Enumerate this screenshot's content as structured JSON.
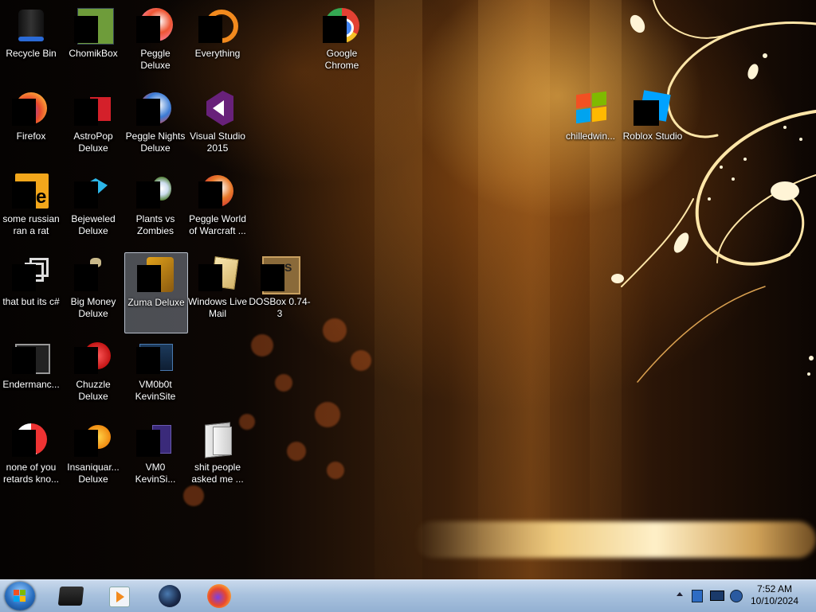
{
  "desktop": {
    "icons": [
      {
        "name": "icon-recycle-bin",
        "label": "Recycle Bin"
      },
      {
        "name": "icon-chomikbox",
        "label": "ChomikBox"
      },
      {
        "name": "icon-peggle-deluxe",
        "label": "Peggle Deluxe"
      },
      {
        "name": "icon-everything",
        "label": "Everything"
      },
      {
        "name": "icon-google-chrome",
        "label": "Google Chrome"
      },
      {
        "name": "icon-firefox",
        "label": "Firefox"
      },
      {
        "name": "icon-astropop-deluxe",
        "label": "AstroPop Deluxe"
      },
      {
        "name": "icon-peggle-nights-deluxe",
        "label": "Peggle Nights Deluxe"
      },
      {
        "name": "icon-visual-studio-2015",
        "label": "Visual Studio 2015"
      },
      {
        "name": "icon-chilledwin",
        "label": "chilledwin..."
      },
      {
        "name": "icon-roblox-studio",
        "label": "Roblox Studio"
      },
      {
        "name": "icon-some-russian-ran-a-rat",
        "label": "some russian ran a rat"
      },
      {
        "name": "icon-bejeweled-deluxe",
        "label": "Bejeweled Deluxe"
      },
      {
        "name": "icon-plants-vs-zombies",
        "label": "Plants vs Zombies"
      },
      {
        "name": "icon-peggle-world-of-warcraft",
        "label": "Peggle World of Warcraft ..."
      },
      {
        "name": "icon-that-but-its-csharp",
        "label": "that but its c#"
      },
      {
        "name": "icon-big-money-deluxe",
        "label": "Big Money Deluxe"
      },
      {
        "name": "icon-zuma-deluxe",
        "label": "Zuma Deluxe"
      },
      {
        "name": "icon-windows-live-mail",
        "label": "Windows Live Mail"
      },
      {
        "name": "icon-dosbox",
        "label": "DOSBox 0.74-3"
      },
      {
        "name": "icon-endermanch",
        "label": "Endermanc..."
      },
      {
        "name": "icon-chuzzle-deluxe",
        "label": "Chuzzle Deluxe"
      },
      {
        "name": "icon-vm0b0t-kevinsite",
        "label": "VM0b0t KevinSite"
      },
      {
        "name": "icon-none-of-you",
        "label": "none of you retards kno..."
      },
      {
        "name": "icon-insaniquarium-deluxe",
        "label": "Insaniquar... Deluxe"
      },
      {
        "name": "icon-vm0-kevinsi",
        "label": "VM0 KevinSi..."
      },
      {
        "name": "icon-shit-people-asked-me",
        "label": "shit people asked me ..."
      }
    ],
    "selected": "Zuma Deluxe"
  },
  "taskbar": {
    "pinned": [
      "start-orb",
      "file-manager-icon",
      "media-player-icon",
      "app-globe-icon",
      "firefox-icon"
    ],
    "tray_icons": [
      "show-hidden-icons-chevron",
      "network-icon",
      "monitor-icon",
      "volume-icon"
    ],
    "clock": {
      "time": "7:52 AM",
      "date": "10/10/2024"
    }
  },
  "colors": {
    "taskbar_top": "#c9d9ec",
    "taskbar_bottom": "#93b0d2",
    "label_text": "#ffffff",
    "selection": "#c8d7eb"
  }
}
